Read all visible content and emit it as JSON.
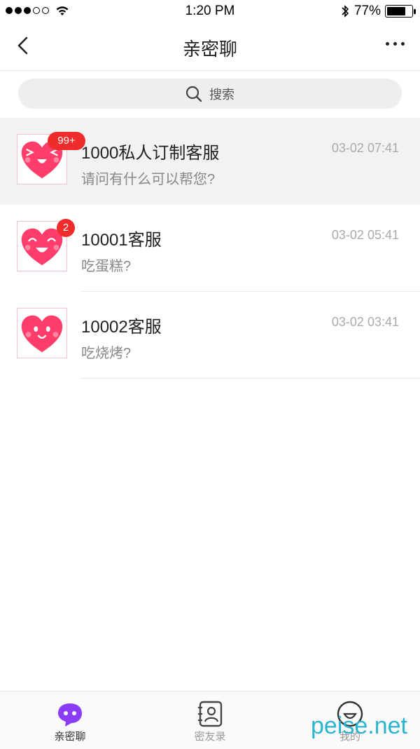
{
  "status_bar": {
    "time": "1:20 PM",
    "battery": "77%",
    "battery_level": 0.77
  },
  "nav": {
    "title": "亲密聊"
  },
  "search": {
    "placeholder": "搜索"
  },
  "chats": [
    {
      "name": "1000私人订制客服",
      "message": "请问有什么可以帮您?",
      "time": "03-02 07:41",
      "badge": "99+"
    },
    {
      "name": "10001客服",
      "message": "吃蛋糕?",
      "time": "03-02 05:41",
      "badge": "2"
    },
    {
      "name": "10002客服",
      "message": "吃烧烤?",
      "time": "03-02 03:41",
      "badge": ""
    }
  ],
  "tabs": [
    {
      "label": "亲密聊",
      "icon": "chat-bubble-icon",
      "active": true
    },
    {
      "label": "密友录",
      "icon": "contacts-icon",
      "active": false
    },
    {
      "label": "我的",
      "icon": "smiley-profile-icon",
      "active": false
    }
  ],
  "colors": {
    "accent": "#8b3cf7",
    "badge": "#f02b2b",
    "heart": "#ff3d6b"
  },
  "watermark": "peise.net"
}
